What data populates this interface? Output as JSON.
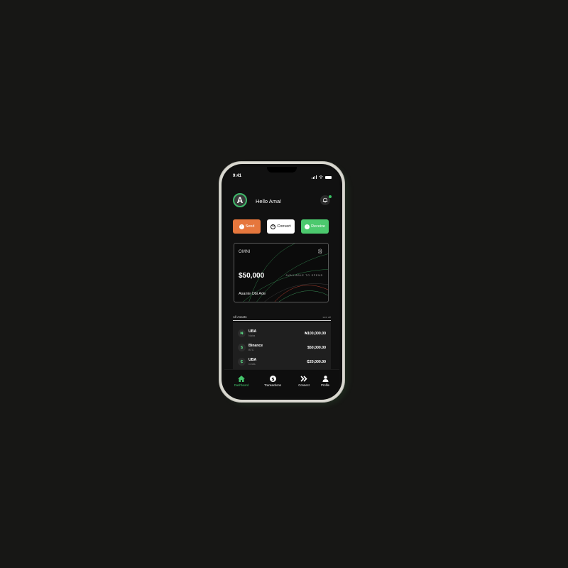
{
  "status": {
    "time": "9:41"
  },
  "header": {
    "avatar_initial": "A",
    "greeting": "Hello Ama!"
  },
  "actions": {
    "send": "Send",
    "convert": "Convert",
    "receive": "Receive"
  },
  "card": {
    "brand": "OMNI",
    "amount": "$50,000",
    "available": "AVAILABLE TO SPEND",
    "holder": "Asante Obi Ade"
  },
  "assets": {
    "title": "All Assets",
    "see_all": "see all",
    "items": [
      {
        "icon": "₦",
        "name": "UBA",
        "sub": "Naira",
        "amount": "₦100,000.00"
      },
      {
        "icon": "$",
        "name": "Binance",
        "sub": "BTC",
        "amount": "$50,000.00"
      },
      {
        "icon": "₵",
        "name": "UBA",
        "sub": "Cedis",
        "amount": "₵20,000.00"
      }
    ]
  },
  "nav": {
    "dashboard": "Dashboard",
    "transactions": "Transactions",
    "connect": "Connect",
    "profile": "Profile"
  },
  "colors": {
    "accent_green": "#45c56c",
    "send_orange": "#e6773d",
    "background": "#171715"
  }
}
